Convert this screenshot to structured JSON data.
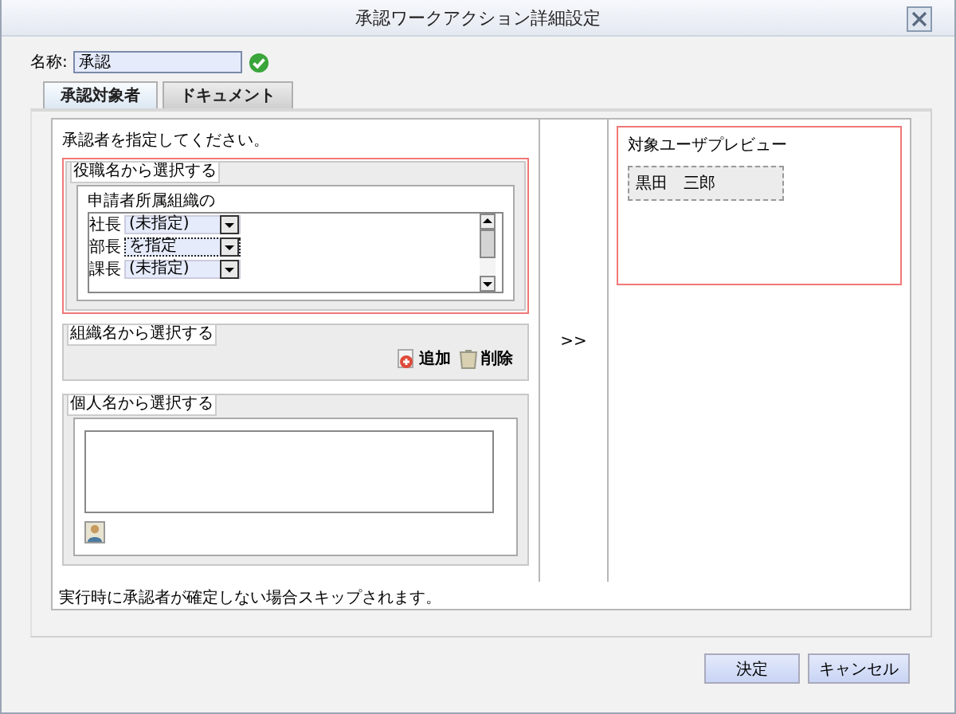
{
  "window": {
    "title": "承認ワークアクション詳細設定"
  },
  "name_field": {
    "label": "名称:",
    "value": "承認",
    "valid": true
  },
  "tabs": [
    {
      "label": "承認対象者",
      "selected": true
    },
    {
      "label": "ドキュメント",
      "selected": false
    }
  ],
  "instruction": "承認者を指定してください。",
  "role_section": {
    "title": "役職名から選択する",
    "caption": "申請者所属組織の",
    "rows": [
      {
        "label": "社長",
        "value": "(未指定)",
        "focused": false
      },
      {
        "label": "部長",
        "value": "を指定",
        "focused": true
      },
      {
        "label": "課長",
        "value": "(未指定)",
        "focused": false
      }
    ]
  },
  "org_section": {
    "title": "組織名から選択する",
    "add": "追加",
    "delete": "削除"
  },
  "person_section": {
    "title": "個人名から選択する"
  },
  "move_button": ">>",
  "preview": {
    "title": "対象ユーザプレビュー",
    "users": [
      "黒田　三郎"
    ]
  },
  "footer_note": "実行時に承認者が確定しない場合スキップされます。",
  "buttons": [
    {
      "label": "決定"
    },
    {
      "label": "キャンセル"
    }
  ]
}
